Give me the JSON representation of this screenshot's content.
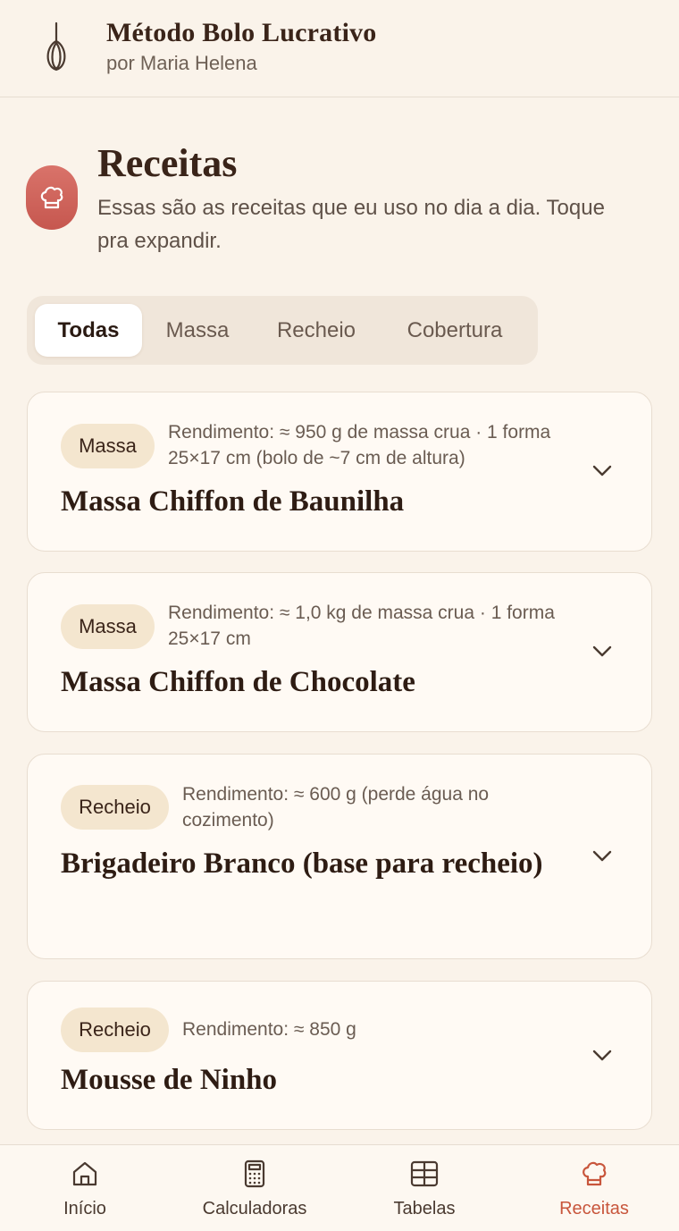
{
  "header": {
    "app_title": "Método Bolo Lucrativo",
    "subtitle": "por Maria Helena",
    "logo_icon": "whisk-icon"
  },
  "page": {
    "icon": "chef-hat-icon",
    "title": "Receitas",
    "description": "Essas são as receitas que eu uso no dia a dia. Toque pra expandir."
  },
  "tabs": [
    {
      "label": "Todas",
      "active": true
    },
    {
      "label": "Massa",
      "active": false
    },
    {
      "label": "Recheio",
      "active": false
    },
    {
      "label": "Cobertura",
      "active": false
    }
  ],
  "recipes": [
    {
      "category": "Massa",
      "yield": "Rendimento: ≈ 950 g de massa crua · 1 forma 25×17 cm (bolo de ~7 cm de altura)",
      "title": "Massa Chiffon de Baunilha"
    },
    {
      "category": "Massa",
      "yield": "Rendimento: ≈ 1,0 kg de massa crua · 1 forma 25×17 cm",
      "title": "Massa Chiffon de Chocolate"
    },
    {
      "category": "Recheio",
      "yield": "Rendimento: ≈ 600 g (perde água no cozimento)",
      "title": "Brigadeiro Branco (base para recheio)"
    },
    {
      "category": "Recheio",
      "yield": "Rendimento: ≈ 850 g",
      "title": "Mousse de Ninho"
    }
  ],
  "nav": [
    {
      "label": "Início",
      "icon": "home-icon",
      "active": false
    },
    {
      "label": "Calculadoras",
      "icon": "calculator-icon",
      "active": false
    },
    {
      "label": "Tabelas",
      "icon": "table-icon",
      "active": false
    },
    {
      "label": "Receitas",
      "icon": "chef-hat-icon",
      "active": true
    }
  ],
  "colors": {
    "background": "#faf3ea",
    "accent": "#c8563c",
    "badge": "#f4e6cf",
    "page_icon": "#cf625a"
  }
}
